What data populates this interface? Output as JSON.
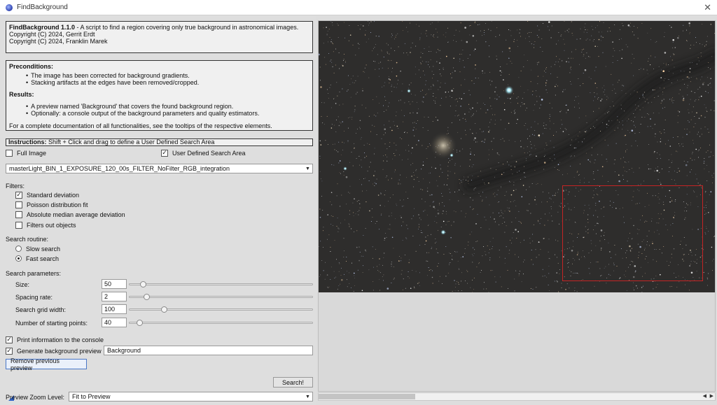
{
  "window": {
    "title": "FindBackground",
    "close_glyph": "✕"
  },
  "about": {
    "name": "FindBackground 1.1.0",
    "description": " - A script to find a region covering only true background in astronomical images.",
    "copyright1": "Copyright (C) 2024, Gerrit Erdt",
    "copyright2": "Copyright (C) 2024, Franklin Marek"
  },
  "info": {
    "preconditions_title": "Preconditions:",
    "preconditions": [
      "The image has been corrected for background gradients.",
      "Stacking artifacts at the edges have been removed/cropped."
    ],
    "results_title": "Results:",
    "results": [
      "A preview named 'Background' that covers the found background region.",
      "Optionally: a console output of the background parameters and quality estimators."
    ],
    "footer": "For a complete documentation of all functionalities, see the tooltips of the respective elements."
  },
  "instructions": {
    "label": "Instructions:",
    "text": " Shift + Click and drag to define a User Defined Search Area"
  },
  "area_options": {
    "full_image": {
      "label": "Full Image",
      "checked": false
    },
    "user_defined": {
      "label": "User Defined Search Area",
      "checked": true
    }
  },
  "image_select": {
    "value": "masterLight_BIN_1_EXPOSURE_120_00s_FILTER_NoFilter_RGB_integration"
  },
  "filters": {
    "title": "Filters:",
    "items": [
      {
        "label": "Standard deviation",
        "checked": true
      },
      {
        "label": "Poisson distribution fit",
        "checked": false
      },
      {
        "label": "Absolute median average deviation",
        "checked": false
      },
      {
        "label": "Filters out objects",
        "checked": false
      }
    ]
  },
  "search_routine": {
    "title": "Search routine:",
    "options": [
      {
        "label": "Slow search",
        "selected": false
      },
      {
        "label": "Fast search",
        "selected": true
      }
    ]
  },
  "search_params": {
    "title": "Search parameters:",
    "items": [
      {
        "label": "Size:",
        "value": "50",
        "slider_fraction": 0.06
      },
      {
        "label": "Spacing rate:",
        "value": "2",
        "slider_fraction": 0.08
      },
      {
        "label": "Search grid width:",
        "value": "100",
        "slider_fraction": 0.18
      },
      {
        "label": "Number of starting points:",
        "value": "40",
        "slider_fraction": 0.04
      }
    ]
  },
  "output": {
    "print_console": {
      "label": "Print information to the console",
      "checked": true
    },
    "generate_preview": {
      "label": "Generate background preview",
      "checked": true,
      "name_value": "Background"
    },
    "remove_button": "Remove previous preview",
    "search_button": "Search!"
  },
  "zoom": {
    "label": "Preview Zoom Level:",
    "value": "Fit to Preview"
  },
  "preview": {
    "search_area_color": "#c42424"
  },
  "colors": {
    "accent": "#2f62c6",
    "check_mark": "✓"
  }
}
